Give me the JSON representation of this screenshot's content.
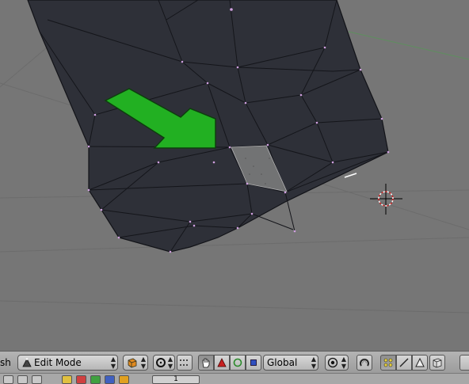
{
  "viewport": {
    "colors": {
      "background": "#767676",
      "mesh": "#2e3038",
      "edge": "#14151a",
      "vertex": "#d0a0e0",
      "arrow": "#22b022",
      "selected_face": "#8a8a8a"
    },
    "icons": [
      "3d-cursor-icon",
      "green-arrow-annotation"
    ]
  },
  "header": {
    "menu_label_partial": "sh",
    "mode_dropdown": {
      "icon": "edit-mode-triangle-icon",
      "label": "Edit Mode"
    },
    "draw_type_icon": "cube-draw-type-icon",
    "pivot_icon": "pivot-icon",
    "manipulator_buttons": [
      "hand-icon",
      "translate-triangle-icon",
      "rotate-circle-icon",
      "scale-square-icon"
    ],
    "orientation_dropdown": {
      "label": "Global"
    },
    "proportional_icon": "proportional-edit-icon",
    "snap_icon": "snap-magnet-icon",
    "select_mode_buttons": [
      "vertex-select-icon",
      "edge-select-icon",
      "face-select-icon"
    ],
    "occlude_icon": "occlude-background-icon"
  },
  "header2": {
    "layer_number": "1"
  }
}
